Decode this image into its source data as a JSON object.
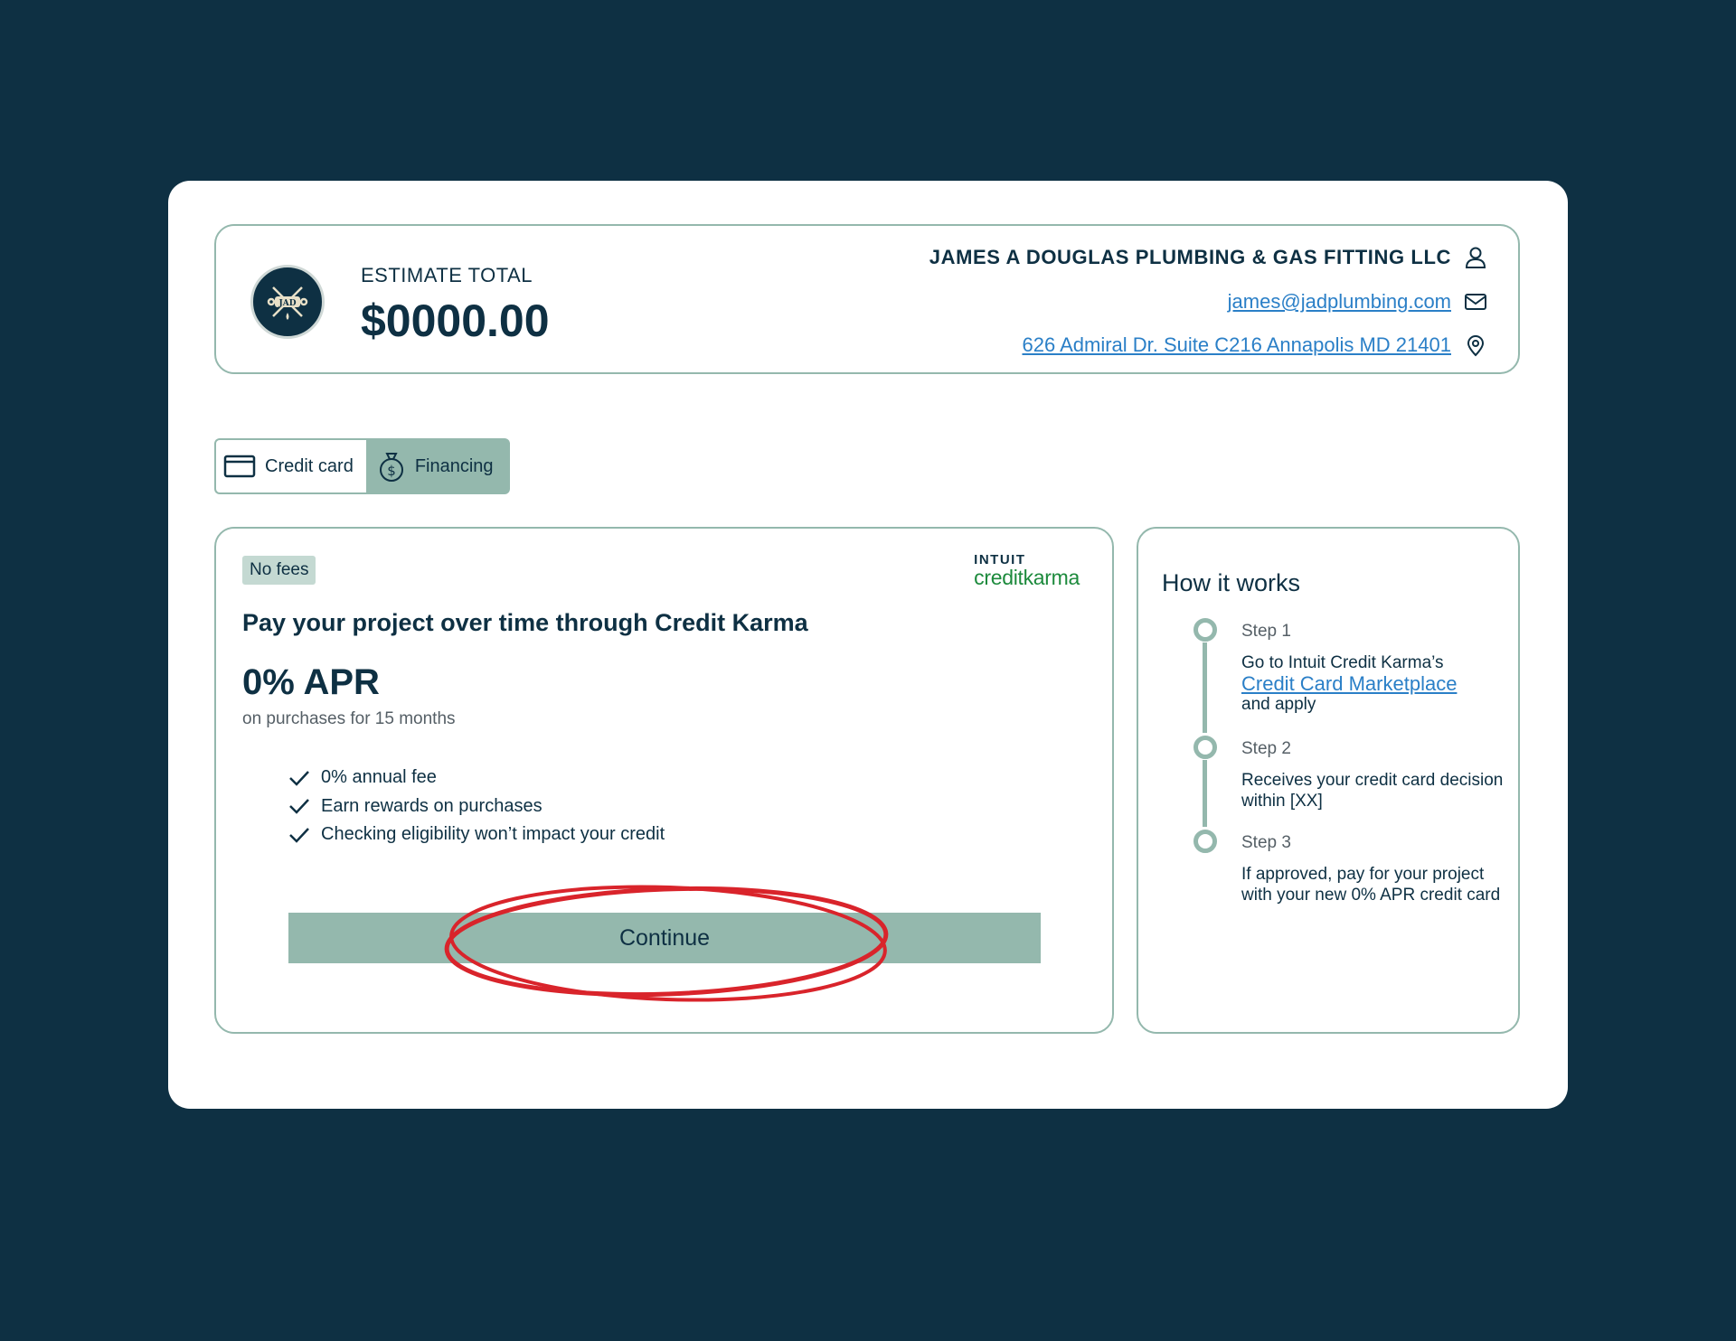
{
  "header": {
    "estimate_label": "ESTIMATE TOTAL",
    "estimate_amount": "$0000.00",
    "business_name": "JAMES A DOUGLAS PLUMBING & GAS FITTING LLC",
    "email": "james@jadplumbing.com",
    "address": "626 Admiral Dr. Suite C216 Annapolis MD 21401",
    "logo_text": "JAD"
  },
  "tabs": [
    {
      "label": "Credit card",
      "icon": "credit-card-icon",
      "active": false
    },
    {
      "label": "Financing",
      "icon": "money-bag-icon",
      "active": true
    }
  ],
  "offer": {
    "badge": "No fees",
    "provider_brand_top": "INTUIT",
    "provider_brand_bottom": "creditkarma",
    "title": "Pay your project over time through Credit Karma",
    "apr": "0% APR",
    "apr_subtitle": "on purchases for 15 months",
    "features": [
      "0% annual fee",
      "Earn rewards on purchases",
      "Checking eligibility won’t impact your credit"
    ],
    "continue_label": "Continue"
  },
  "how_it_works": {
    "title": "How it works",
    "steps": [
      {
        "label": "Step 1",
        "text_before": "Go to Intuit Credit Karma’s",
        "link": "Credit Card Marketplace",
        "text_after": "and apply"
      },
      {
        "label": "Step 2",
        "text": "Receives your credit card decision within [XX]"
      },
      {
        "label": "Step 3",
        "text": "If approved, pay for your project with your new 0% APR credit card"
      }
    ]
  },
  "colors": {
    "background": "#0e3043",
    "accent": "#94b8ad",
    "link": "#2a7fc7",
    "brand_green": "#1c8a3c",
    "highlight_ring": "#d9242b"
  }
}
